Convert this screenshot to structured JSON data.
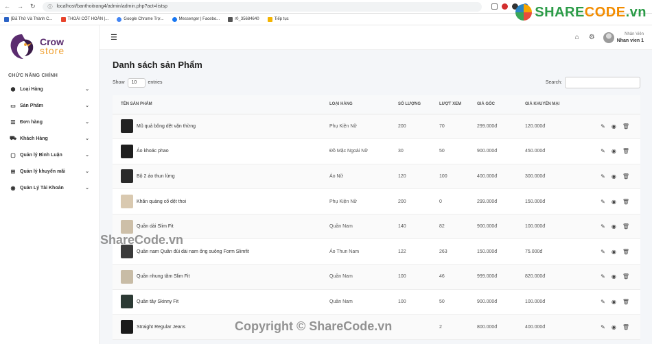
{
  "browser": {
    "url": "localhost/banthoitrang4/admin/admin.php?act=listsp",
    "bookmarks": [
      "[Đã Thử Và Thành C...",
      "THOẢI CỐT HOÀN |...",
      "Google Chrome Trợ...",
      "Messenger | Facebo...",
      "r0_35684640",
      "Tiếp tục"
    ]
  },
  "watermark": {
    "brand_green": "SHARE",
    "brand_orange": "CODE",
    "brand_suffix": ".vn",
    "mid": "ShareCode.vn",
    "bottom": "Copyright © ShareCode.vn"
  },
  "logo": {
    "line1": "Crow",
    "line2": "store"
  },
  "sidebar": {
    "title": "CHỨC NĂNG CHÍNH",
    "items": [
      {
        "label": "Loại Hàng",
        "icon": "cube-icon"
      },
      {
        "label": "Sản Phẩm",
        "icon": "box-icon"
      },
      {
        "label": "Đơn hàng",
        "icon": "order-icon"
      },
      {
        "label": "Khách Hàng",
        "icon": "truck-icon"
      },
      {
        "label": "Quản lý Bình Luận",
        "icon": "comment-icon"
      },
      {
        "label": "Quản lý khuyến mãi",
        "icon": "promotion-icon"
      },
      {
        "label": "Quản Lý Tài Khoản",
        "icon": "account-icon"
      }
    ]
  },
  "topbar": {
    "role": "Nhân Viên",
    "username": "Nhan vien 1"
  },
  "page": {
    "title": "Danh sách sản Phẩm",
    "show_label": "Show",
    "entries_value": "10",
    "entries_label": "entries",
    "search_label": "Search:"
  },
  "table": {
    "headers": [
      "TÊN SẢN PHẨM",
      "LOẠI HÀNG",
      "SỐ LƯỢNG",
      "LƯỢT XEM",
      "GIÁ GỐC",
      "GIÁ KHUYẾN MẠI"
    ],
    "rows": [
      {
        "name": "Mũ quả bông dệt vặn thừng",
        "category": "Phụ Kiện Nữ",
        "qty": "200",
        "views": "70",
        "price": "299.000đ",
        "sale": "120.000đ",
        "thumb": "#222222"
      },
      {
        "name": "Áo khoác phao",
        "category": "Đồ Mặc Ngoài Nữ",
        "qty": "30",
        "views": "50",
        "price": "900.000đ",
        "sale": "450.000đ",
        "thumb": "#1e1e1e"
      },
      {
        "name": "Bộ 2 áo thun lửng",
        "category": "Áo Nữ",
        "qty": "120",
        "views": "100",
        "price": "400.000đ",
        "sale": "300.000đ",
        "thumb": "#2a2a2a"
      },
      {
        "name": "Khăn quàng cổ dệt thoi",
        "category": "Phụ Kiện Nữ",
        "qty": "200",
        "views": "0",
        "price": "299.000đ",
        "sale": "150.000đ",
        "thumb": "#d9c9b0"
      },
      {
        "name": "Quần dài Slim Fit",
        "category": "Quần Nam",
        "qty": "140",
        "views": "82",
        "price": "900.000đ",
        "sale": "100.000đ",
        "thumb": "#cdbfa8"
      },
      {
        "name": "Quần nam Quần đùi dài nam ống suông Form Slimfit",
        "category": "Áo Thun Nam",
        "qty": "122",
        "views": "263",
        "price": "150.000đ",
        "sale": "75.000đ",
        "thumb": "#3a3a3a"
      },
      {
        "name": "Quần nhung tăm Slim Fit",
        "category": "Quần Nam",
        "qty": "100",
        "views": "46",
        "price": "999.000đ",
        "sale": "820.000đ",
        "thumb": "#c8bca6"
      },
      {
        "name": "Quần tây Skinny Fit",
        "category": "Quần Nam",
        "qty": "100",
        "views": "50",
        "price": "900.000đ",
        "sale": "100.000đ",
        "thumb": "#2c3a34"
      },
      {
        "name": "Straight Regular Jeans",
        "category": "",
        "qty": "",
        "views": "2",
        "price": "800.000đ",
        "sale": "400.000đ",
        "thumb": "#1a1a1a"
      }
    ]
  }
}
